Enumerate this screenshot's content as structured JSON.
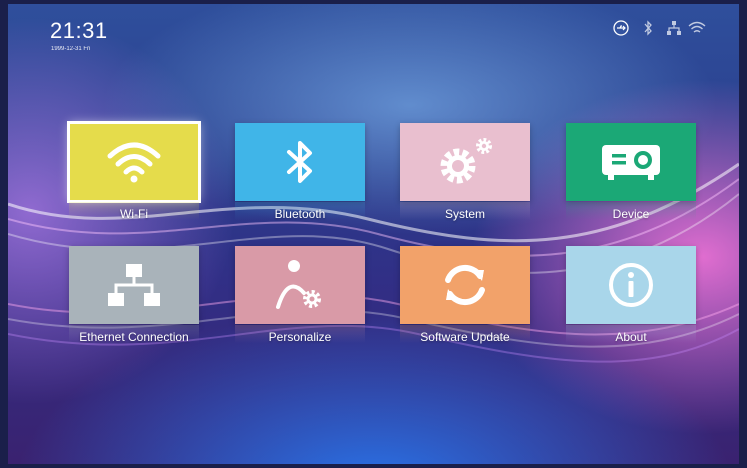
{
  "status_bar": {
    "time": "21:31",
    "date": "1999-12-31 Fri",
    "icons": [
      "usb-icon",
      "bluetooth-icon",
      "ethernet-icon",
      "wifi-icon"
    ]
  },
  "menu": {
    "tiles": [
      {
        "label": "Wi-Fi",
        "icon": "wifi-icon",
        "color": "#e5dc4b",
        "selected": true
      },
      {
        "label": "Bluetooth",
        "icon": "bluetooth-icon",
        "color": "#40b5e8",
        "selected": false
      },
      {
        "label": "System",
        "icon": "gear-icon",
        "color": "#e9bfcf",
        "selected": false
      },
      {
        "label": "Device",
        "icon": "projector-icon",
        "color": "#1ba876",
        "selected": false
      },
      {
        "label": "Ethernet Connection",
        "icon": "ethernet-icon",
        "color": "#a9b3ba",
        "selected": false
      },
      {
        "label": "Personalize",
        "icon": "personalize-icon",
        "color": "#d99aa7",
        "selected": false
      },
      {
        "label": "Software Update",
        "icon": "refresh-icon",
        "color": "#f2a26a",
        "selected": false
      },
      {
        "label": "About",
        "icon": "info-icon",
        "color": "#a9d6ea",
        "selected": false
      }
    ]
  }
}
